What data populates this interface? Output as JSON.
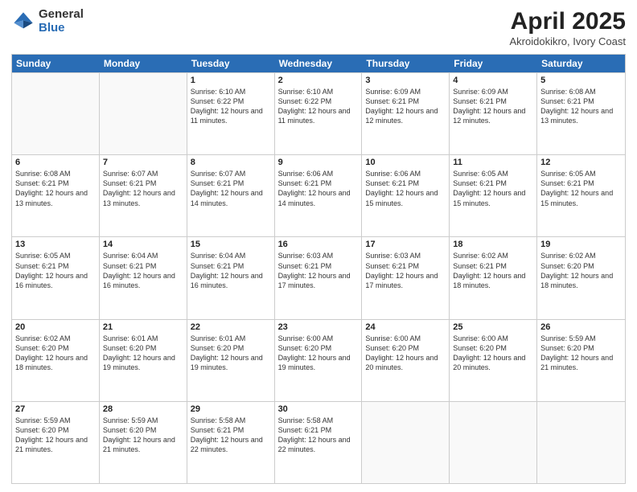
{
  "logo": {
    "general": "General",
    "blue": "Blue"
  },
  "title": {
    "month": "April 2025",
    "location": "Akroidokikro, Ivory Coast"
  },
  "header_days": [
    "Sunday",
    "Monday",
    "Tuesday",
    "Wednesday",
    "Thursday",
    "Friday",
    "Saturday"
  ],
  "weeks": [
    [
      {
        "day": "",
        "sunrise": "",
        "sunset": "",
        "daylight": ""
      },
      {
        "day": "",
        "sunrise": "",
        "sunset": "",
        "daylight": ""
      },
      {
        "day": "1",
        "sunrise": "Sunrise: 6:10 AM",
        "sunset": "Sunset: 6:22 PM",
        "daylight": "Daylight: 12 hours and 11 minutes."
      },
      {
        "day": "2",
        "sunrise": "Sunrise: 6:10 AM",
        "sunset": "Sunset: 6:22 PM",
        "daylight": "Daylight: 12 hours and 11 minutes."
      },
      {
        "day": "3",
        "sunrise": "Sunrise: 6:09 AM",
        "sunset": "Sunset: 6:21 PM",
        "daylight": "Daylight: 12 hours and 12 minutes."
      },
      {
        "day": "4",
        "sunrise": "Sunrise: 6:09 AM",
        "sunset": "Sunset: 6:21 PM",
        "daylight": "Daylight: 12 hours and 12 minutes."
      },
      {
        "day": "5",
        "sunrise": "Sunrise: 6:08 AM",
        "sunset": "Sunset: 6:21 PM",
        "daylight": "Daylight: 12 hours and 13 minutes."
      }
    ],
    [
      {
        "day": "6",
        "sunrise": "Sunrise: 6:08 AM",
        "sunset": "Sunset: 6:21 PM",
        "daylight": "Daylight: 12 hours and 13 minutes."
      },
      {
        "day": "7",
        "sunrise": "Sunrise: 6:07 AM",
        "sunset": "Sunset: 6:21 PM",
        "daylight": "Daylight: 12 hours and 13 minutes."
      },
      {
        "day": "8",
        "sunrise": "Sunrise: 6:07 AM",
        "sunset": "Sunset: 6:21 PM",
        "daylight": "Daylight: 12 hours and 14 minutes."
      },
      {
        "day": "9",
        "sunrise": "Sunrise: 6:06 AM",
        "sunset": "Sunset: 6:21 PM",
        "daylight": "Daylight: 12 hours and 14 minutes."
      },
      {
        "day": "10",
        "sunrise": "Sunrise: 6:06 AM",
        "sunset": "Sunset: 6:21 PM",
        "daylight": "Daylight: 12 hours and 15 minutes."
      },
      {
        "day": "11",
        "sunrise": "Sunrise: 6:05 AM",
        "sunset": "Sunset: 6:21 PM",
        "daylight": "Daylight: 12 hours and 15 minutes."
      },
      {
        "day": "12",
        "sunrise": "Sunrise: 6:05 AM",
        "sunset": "Sunset: 6:21 PM",
        "daylight": "Daylight: 12 hours and 15 minutes."
      }
    ],
    [
      {
        "day": "13",
        "sunrise": "Sunrise: 6:05 AM",
        "sunset": "Sunset: 6:21 PM",
        "daylight": "Daylight: 12 hours and 16 minutes."
      },
      {
        "day": "14",
        "sunrise": "Sunrise: 6:04 AM",
        "sunset": "Sunset: 6:21 PM",
        "daylight": "Daylight: 12 hours and 16 minutes."
      },
      {
        "day": "15",
        "sunrise": "Sunrise: 6:04 AM",
        "sunset": "Sunset: 6:21 PM",
        "daylight": "Daylight: 12 hours and 16 minutes."
      },
      {
        "day": "16",
        "sunrise": "Sunrise: 6:03 AM",
        "sunset": "Sunset: 6:21 PM",
        "daylight": "Daylight: 12 hours and 17 minutes."
      },
      {
        "day": "17",
        "sunrise": "Sunrise: 6:03 AM",
        "sunset": "Sunset: 6:21 PM",
        "daylight": "Daylight: 12 hours and 17 minutes."
      },
      {
        "day": "18",
        "sunrise": "Sunrise: 6:02 AM",
        "sunset": "Sunset: 6:21 PM",
        "daylight": "Daylight: 12 hours and 18 minutes."
      },
      {
        "day": "19",
        "sunrise": "Sunrise: 6:02 AM",
        "sunset": "Sunset: 6:20 PM",
        "daylight": "Daylight: 12 hours and 18 minutes."
      }
    ],
    [
      {
        "day": "20",
        "sunrise": "Sunrise: 6:02 AM",
        "sunset": "Sunset: 6:20 PM",
        "daylight": "Daylight: 12 hours and 18 minutes."
      },
      {
        "day": "21",
        "sunrise": "Sunrise: 6:01 AM",
        "sunset": "Sunset: 6:20 PM",
        "daylight": "Daylight: 12 hours and 19 minutes."
      },
      {
        "day": "22",
        "sunrise": "Sunrise: 6:01 AM",
        "sunset": "Sunset: 6:20 PM",
        "daylight": "Daylight: 12 hours and 19 minutes."
      },
      {
        "day": "23",
        "sunrise": "Sunrise: 6:00 AM",
        "sunset": "Sunset: 6:20 PM",
        "daylight": "Daylight: 12 hours and 19 minutes."
      },
      {
        "day": "24",
        "sunrise": "Sunrise: 6:00 AM",
        "sunset": "Sunset: 6:20 PM",
        "daylight": "Daylight: 12 hours and 20 minutes."
      },
      {
        "day": "25",
        "sunrise": "Sunrise: 6:00 AM",
        "sunset": "Sunset: 6:20 PM",
        "daylight": "Daylight: 12 hours and 20 minutes."
      },
      {
        "day": "26",
        "sunrise": "Sunrise: 5:59 AM",
        "sunset": "Sunset: 6:20 PM",
        "daylight": "Daylight: 12 hours and 21 minutes."
      }
    ],
    [
      {
        "day": "27",
        "sunrise": "Sunrise: 5:59 AM",
        "sunset": "Sunset: 6:20 PM",
        "daylight": "Daylight: 12 hours and 21 minutes."
      },
      {
        "day": "28",
        "sunrise": "Sunrise: 5:59 AM",
        "sunset": "Sunset: 6:20 PM",
        "daylight": "Daylight: 12 hours and 21 minutes."
      },
      {
        "day": "29",
        "sunrise": "Sunrise: 5:58 AM",
        "sunset": "Sunset: 6:21 PM",
        "daylight": "Daylight: 12 hours and 22 minutes."
      },
      {
        "day": "30",
        "sunrise": "Sunrise: 5:58 AM",
        "sunset": "Sunset: 6:21 PM",
        "daylight": "Daylight: 12 hours and 22 minutes."
      },
      {
        "day": "",
        "sunrise": "",
        "sunset": "",
        "daylight": ""
      },
      {
        "day": "",
        "sunrise": "",
        "sunset": "",
        "daylight": ""
      },
      {
        "day": "",
        "sunrise": "",
        "sunset": "",
        "daylight": ""
      }
    ]
  ]
}
